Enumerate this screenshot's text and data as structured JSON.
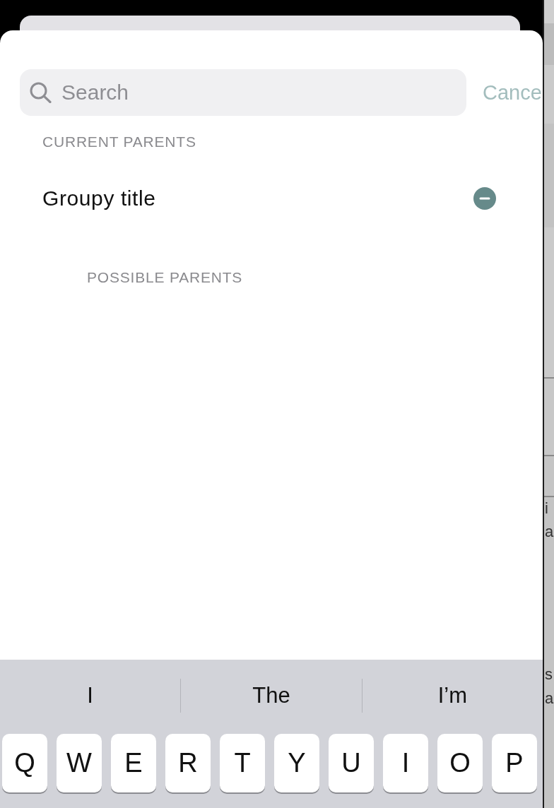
{
  "search": {
    "placeholder": "Search"
  },
  "cancel_button": {
    "label": "Cance"
  },
  "sections": [
    {
      "kind": "current",
      "header": "CURRENT PARENTS",
      "items": [
        {
          "title": "Groupy title",
          "kind": "removable"
        }
      ]
    },
    {
      "kind": "possible",
      "header": "POSSIBLE PARENTS"
    }
  ],
  "keyboard": {
    "suggestions": [
      "I",
      "The",
      "I’m"
    ],
    "keys": [
      "Q",
      "W",
      "E",
      "R",
      "T",
      "Y",
      "U",
      "I",
      "O",
      "P"
    ]
  },
  "background_app": {
    "fragments": [
      "i",
      "a",
      "s",
      "a"
    ]
  }
}
